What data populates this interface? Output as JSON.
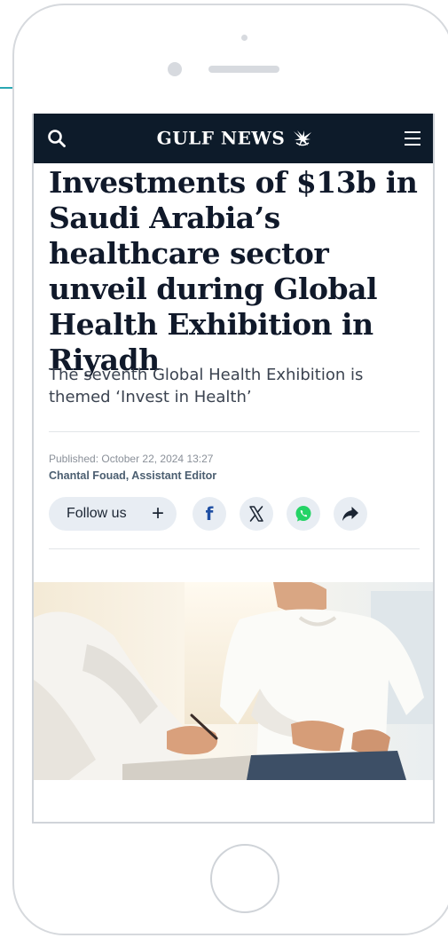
{
  "header": {
    "logo_text": "GULF NEWS",
    "search_icon": "search-icon",
    "menu_icon": "hamburger-menu-icon",
    "logo_icon": "eagle-emblem-icon"
  },
  "article": {
    "headline": "Investments of $13b in Saudi Arabia’s healthcare sector unveil during Global Health Exhibition in Riyadh",
    "subhead": "The seventh Global Health Exhibition is themed ‘Invest in Health’",
    "published": "Published: October 22, 2024 13:27",
    "author": "Chantal Fouad, Assistant Editor",
    "image_subject": "doctor writing notes beside patient in white t-shirt"
  },
  "share": {
    "follow_label": "Follow us",
    "follow_icon": "plus-icon",
    "facebook_label": "f",
    "x_icon": "x-icon",
    "whatsapp_icon": "whatsapp-icon",
    "share_icon": "share-arrow-icon"
  },
  "colors": {
    "topbar": "#0d1b2a",
    "headline": "#10192a",
    "share_bg": "#e8edf3",
    "facebook": "#1f4fa3",
    "whatsapp": "#25d366"
  }
}
